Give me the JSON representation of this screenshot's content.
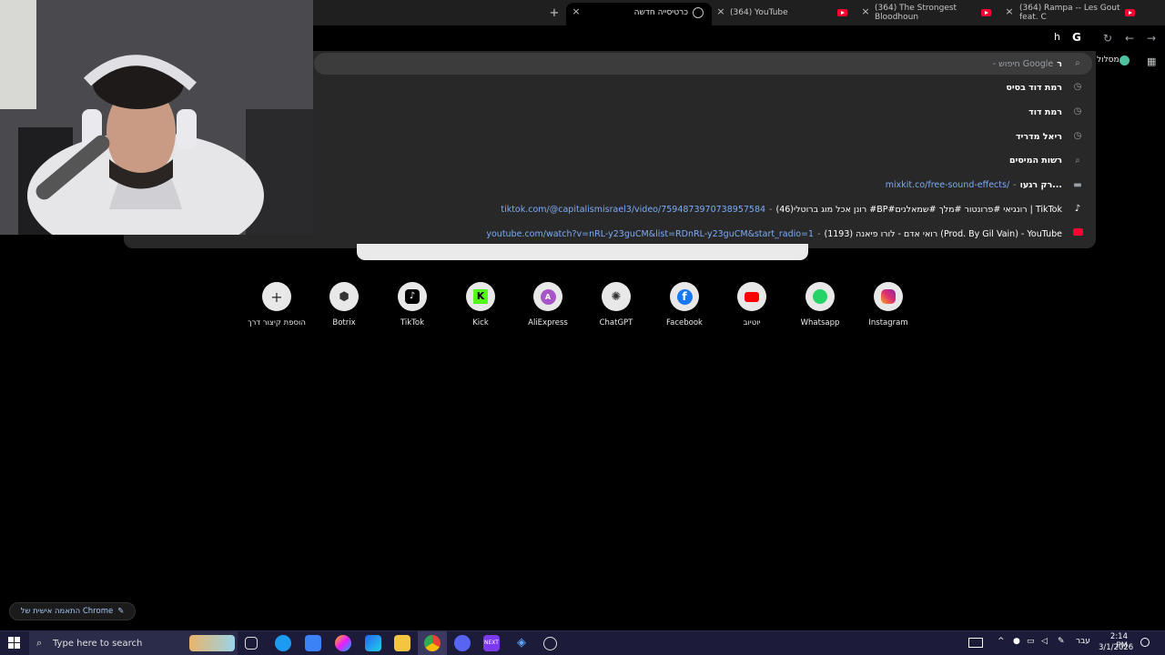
{
  "tabs": [
    {
      "title": "כרטיסייה חדשה"
    },
    {
      "title": "(364) YouTube"
    },
    {
      "title": "(364) The Strongest Bloodhoun"
    },
    {
      "title": "(364) Rampa -- Les Gout feat. C"
    }
  ],
  "omnibox": {
    "typed": "h",
    "search_query": "ר",
    "search_suffix": "- חיפוש Google"
  },
  "bookmarks": {
    "label": "מסלול"
  },
  "suggestions": [
    {
      "icon": "history-icon",
      "text": "רמת דוד בסיס"
    },
    {
      "icon": "history-icon",
      "text": "רמת דוד"
    },
    {
      "icon": "history-icon",
      "text": "ריאל מדריד"
    },
    {
      "icon": "search-icon",
      "text": "רשות המיסים"
    },
    {
      "icon": "page-icon",
      "text": "רק רגעו...",
      "url": "mixkit.co/free-sound-effects/"
    },
    {
      "icon": "tiktok-icon",
      "text": "(46)רונן אכל מוג ברוטלי #BP#רונגיאי #פרונטור #מלך #שמאלנים | TikTok",
      "url": "tiktok.com/@capitalismisrael3/video/7594873970738957584"
    },
    {
      "icon": "youtube-icon",
      "text": "(1193) רואי אדם - לורו פיאנה (Prod. By Gil Vain) - YouTube",
      "url": "youtube.com/watch?v=nRL-y23guCM&list=RDnRL-y23guCM&start_radio=1"
    }
  ],
  "shortcuts": [
    {
      "label": "Instagram",
      "icon": "instagram-icon",
      "color": "#e1306c"
    },
    {
      "label": "Whatsapp",
      "icon": "whatsapp-icon",
      "color": "#25d366"
    },
    {
      "label": "יוטיוב",
      "icon": "youtube-icon",
      "color": "#ff0000"
    },
    {
      "label": "Facebook",
      "icon": "facebook-icon",
      "color": "#1877f2"
    },
    {
      "label": "ChatGPT",
      "icon": "chatgpt-icon",
      "color": "#444444"
    },
    {
      "label": "AliExpress",
      "icon": "aliexpress-icon",
      "color": "#a855c8"
    },
    {
      "label": "Kick",
      "icon": "kick-icon",
      "color": "#53fc18"
    },
    {
      "label": "TikTok",
      "icon": "tiktok-icon",
      "color": "#000000"
    },
    {
      "label": "Botrix",
      "icon": "botrix-icon",
      "color": "#333333"
    },
    {
      "label": "הוספת קיצור דרך",
      "icon": "plus-icon",
      "color": "#333333"
    }
  ],
  "customize_label": "התאמה אישית של Chrome",
  "taskbar": {
    "search_placeholder": "Type here to search",
    "lang": "עבר",
    "time": "2:14 PM",
    "date": "3/1/2026"
  }
}
